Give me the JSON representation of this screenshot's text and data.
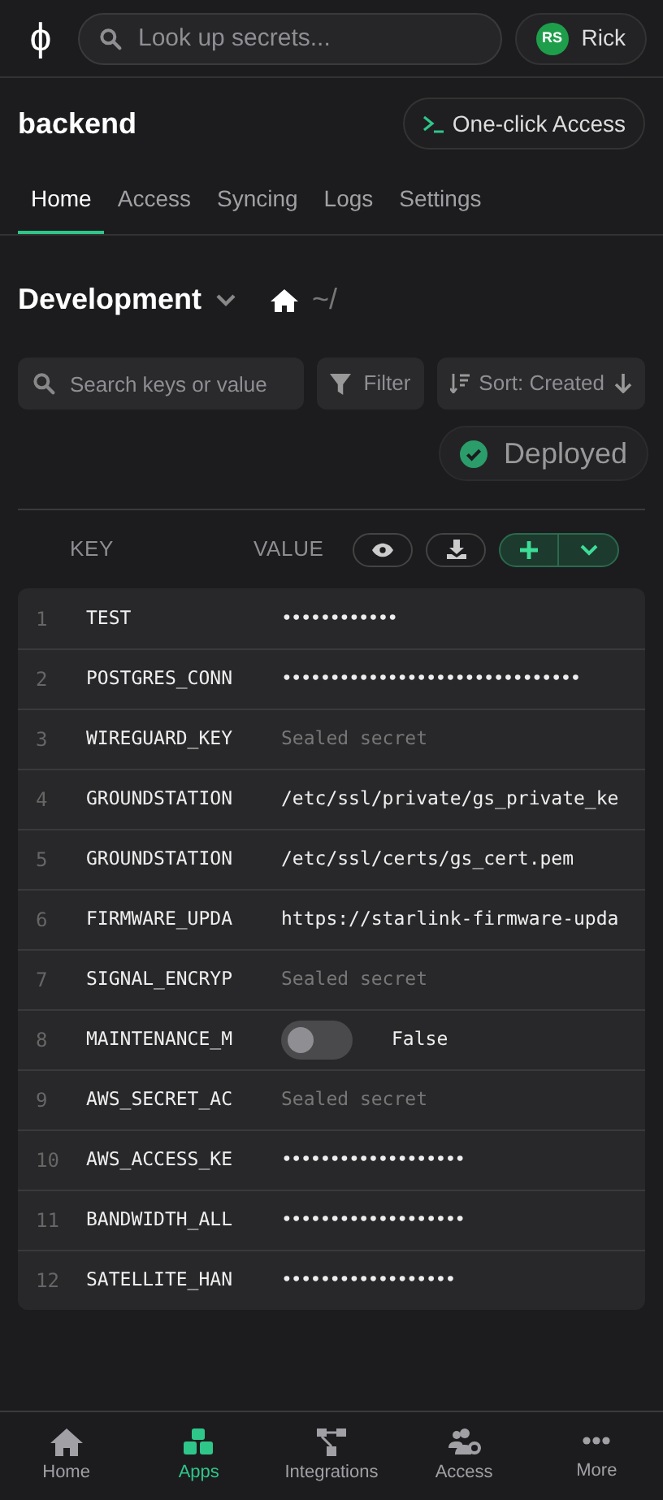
{
  "header": {
    "logo": "ϕ",
    "search": {
      "placeholder": "Look up secrets..."
    },
    "user": {
      "initials": "RS",
      "name": "Rick"
    }
  },
  "app": {
    "title": "backend",
    "access_button": "One-click Access"
  },
  "tabs": [
    {
      "label": "Home",
      "selected": true
    },
    {
      "label": "Access",
      "selected": false
    },
    {
      "label": "Syncing",
      "selected": false
    },
    {
      "label": "Logs",
      "selected": false
    },
    {
      "label": "Settings",
      "selected": false
    }
  ],
  "environment": {
    "name": "Development",
    "path": "~/"
  },
  "toolbar": {
    "search": {
      "placeholder": "Search keys or value"
    },
    "filter": "Filter",
    "sort": "Sort: Created",
    "status": "Deployed"
  },
  "table": {
    "columns": [
      "KEY",
      "VALUE"
    ],
    "rows": [
      {
        "index": "1",
        "key": "TEST",
        "kind": "masked",
        "value": "••••••••••••"
      },
      {
        "index": "2",
        "key": "POSTGRES_CONN",
        "kind": "masked",
        "value": "•••••••••••••••••••••••••••••••"
      },
      {
        "index": "3",
        "key": "WIREGUARD_KEY",
        "kind": "sealed",
        "value": "Sealed secret"
      },
      {
        "index": "4",
        "key": "GROUNDSTATION",
        "kind": "text",
        "value": "/etc/ssl/private/gs_private_ke"
      },
      {
        "index": "5",
        "key": "GROUNDSTATION",
        "kind": "text",
        "value": "/etc/ssl/certs/gs_cert.pem"
      },
      {
        "index": "6",
        "key": "FIRMWARE_UPDA",
        "kind": "text",
        "value": "https://starlink-firmware-upda"
      },
      {
        "index": "7",
        "key": "SIGNAL_ENCRYP",
        "kind": "sealed",
        "value": "Sealed secret"
      },
      {
        "index": "8",
        "key": "MAINTENANCE_M",
        "kind": "toggle",
        "on": false,
        "value": "False"
      },
      {
        "index": "9",
        "key": "AWS_SECRET_AC",
        "kind": "sealed",
        "value": "Sealed secret"
      },
      {
        "index": "10",
        "key": "AWS_ACCESS_KE",
        "kind": "masked",
        "value": "•••••••••••••••••••"
      },
      {
        "index": "11",
        "key": "BANDWIDTH_ALL",
        "kind": "masked",
        "value": "•••••••••••••••••••"
      },
      {
        "index": "12",
        "key": "SATELLITE_HAN",
        "kind": "masked",
        "value": "••••••••••••••••••"
      }
    ]
  },
  "bottom_nav": [
    {
      "label": "Home",
      "kind": "home",
      "selected": false
    },
    {
      "label": "Apps",
      "kind": "apps",
      "selected": true
    },
    {
      "label": "Integrations",
      "kind": "integrations",
      "selected": false
    },
    {
      "label": "Access",
      "kind": "access",
      "selected": false
    },
    {
      "label": "More",
      "kind": "more",
      "selected": false
    }
  ]
}
